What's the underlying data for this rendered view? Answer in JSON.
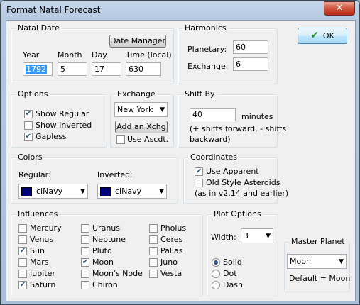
{
  "window": {
    "title": "Format Natal Forecast",
    "close_glyph": "✕"
  },
  "ok_label": "OK",
  "natal_date": {
    "group_label": "Natal Date",
    "date_manager": "Date Manager",
    "labels": {
      "year": "Year",
      "month": "Month",
      "day": "Day",
      "time": "Time (local)"
    },
    "values": {
      "year": "1792",
      "month": "5",
      "day": "17",
      "time": "630"
    }
  },
  "harmonics": {
    "group_label": "Harmonics",
    "planetary_label": "Planetary:",
    "planetary_value": "60",
    "exchange_label": "Exchange:",
    "exchange_value": "6"
  },
  "options": {
    "group_label": "Options",
    "items": [
      {
        "label": "Show Regular",
        "checked": true
      },
      {
        "label": "Show Inverted",
        "checked": false
      },
      {
        "label": "Gapless",
        "checked": true
      }
    ]
  },
  "exchange": {
    "group_label": "Exchange",
    "selected": "New York",
    "add_button": "Add an Xchg",
    "use_ascdt": "Use Ascdt.",
    "use_ascdt_checked": false
  },
  "shift_by": {
    "group_label": "Shift By",
    "value": "40",
    "unit": "minutes",
    "hint_line1": "(+ shifts forward, - shifts",
    "hint_line2": "backward)"
  },
  "colors": {
    "group_label": "Colors",
    "regular_label": "Regular:",
    "regular_value": "clNavy",
    "inverted_label": "Inverted:",
    "inverted_value": "clNavy",
    "swatch_color": "#000080"
  },
  "coordinates": {
    "group_label": "Coordinates",
    "use_apparent": "Use Apparent",
    "use_apparent_checked": true,
    "old_style": "Old Style Asteroids",
    "old_style_checked": false,
    "old_style_note": "(as in v2.14 and earlier)"
  },
  "influences": {
    "group_label": "Influences",
    "col1": [
      {
        "label": "Mercury",
        "checked": false
      },
      {
        "label": "Venus",
        "checked": false
      },
      {
        "label": "Sun",
        "checked": true
      },
      {
        "label": "Mars",
        "checked": false
      },
      {
        "label": "Jupiter",
        "checked": false
      },
      {
        "label": "Saturn",
        "checked": true
      }
    ],
    "col2": [
      {
        "label": "Uranus",
        "checked": false
      },
      {
        "label": "Neptune",
        "checked": false
      },
      {
        "label": "Pluto",
        "checked": false
      },
      {
        "label": "Moon",
        "checked": true
      },
      {
        "label": "Moon's Node",
        "checked": false
      },
      {
        "label": "Chiron",
        "checked": false
      }
    ],
    "col3": [
      {
        "label": "Pholus",
        "checked": false
      },
      {
        "label": "Ceres",
        "checked": false
      },
      {
        "label": "Pallas",
        "checked": false
      },
      {
        "label": "Juno",
        "checked": false
      },
      {
        "label": "Vesta",
        "checked": false
      }
    ]
  },
  "plot_options": {
    "group_label": "Plot Options",
    "width_label": "Width:",
    "width_value": "3",
    "styles": [
      {
        "label": "Solid",
        "selected": true
      },
      {
        "label": "Dot",
        "selected": false
      },
      {
        "label": "Dash",
        "selected": false
      }
    ]
  },
  "master_planet": {
    "group_label": "Master Planet",
    "selected": "Moon",
    "default_note": "Default = Moon"
  }
}
